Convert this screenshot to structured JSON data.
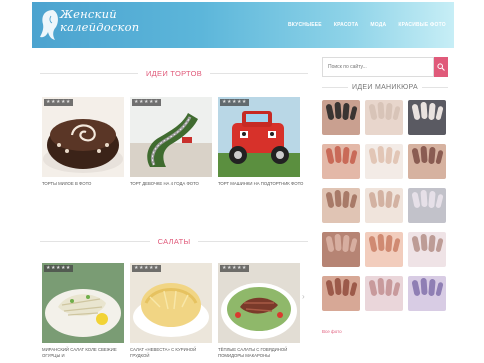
{
  "header": {
    "logo_line1": "Женский",
    "logo_line2": "калейдоскоп",
    "nav": [
      "ВКУСНЫЕЕЕ",
      "КРАСОТА",
      "МОДА",
      "КРАСИВЫЕ ФОТО"
    ]
  },
  "sections": [
    {
      "title": "ИДЕИ ТОРТОВ",
      "cards": [
        {
          "stars": "★★★★★",
          "caption": "ТОРТЫ МИЛОЕ В ФОТО"
        },
        {
          "stars": "★★★★★",
          "caption": "ТОРТ ДЕВОЧКЕ НА 4 ГОДА ФОТО"
        },
        {
          "stars": "★★★★★",
          "caption": "ТОРТ МАШИНКИ НА ПОДТОРТНИК ФОТО"
        }
      ]
    },
    {
      "title": "САЛАТЫ",
      "cards": [
        {
          "stars": "★★★★★",
          "caption": "МИРАНСКИЙ САЛАТ КОЛЕ СВЕЖИЕ ОГУРЦЫ И"
        },
        {
          "stars": "★★★★★",
          "caption": "САЛАТ «НЕВЕСТА» С КУРИНОЙ ГРУДКОЙ"
        },
        {
          "stars": "★★★★★",
          "caption": "ТЁПЛЫЕ САЛАТЫ С ГОВЯДИНОЙ ПОМИДОРЫ МАКАРОНЫ"
        }
      ]
    }
  ],
  "sidebar": {
    "search_placeholder": "Поиск по сайту...",
    "title": "ИДЕИ МАНИКЮРА",
    "more_link": "Все фото",
    "nail_colors": [
      [
        "#3a3432",
        "#c9a090"
      ],
      [
        "#d8c4b8",
        "#e8d6cc"
      ],
      [
        "#e9e2df",
        "#5a5a62"
      ],
      [
        "#c96a58",
        "#e3b8a8"
      ],
      [
        "#e2c6b6",
        "#f3ebe6"
      ],
      [
        "#8a5c52",
        "#d6b2a0"
      ],
      [
        "#a87a68",
        "#e0c4b4"
      ],
      [
        "#d3b2a2",
        "#f0e4dc"
      ],
      [
        "#e6e0e8",
        "#c2c2ca"
      ],
      [
        "#d7aea0",
        "#b68474"
      ],
      [
        "#d08a72",
        "#f2cdbd"
      ],
      [
        "#bd9c96",
        "#efe3e6"
      ],
      [
        "#9c5a4a",
        "#d7a896"
      ],
      [
        "#c89a9c",
        "#ead6da"
      ],
      [
        "#8f7fb4",
        "#d8cce4"
      ]
    ]
  }
}
